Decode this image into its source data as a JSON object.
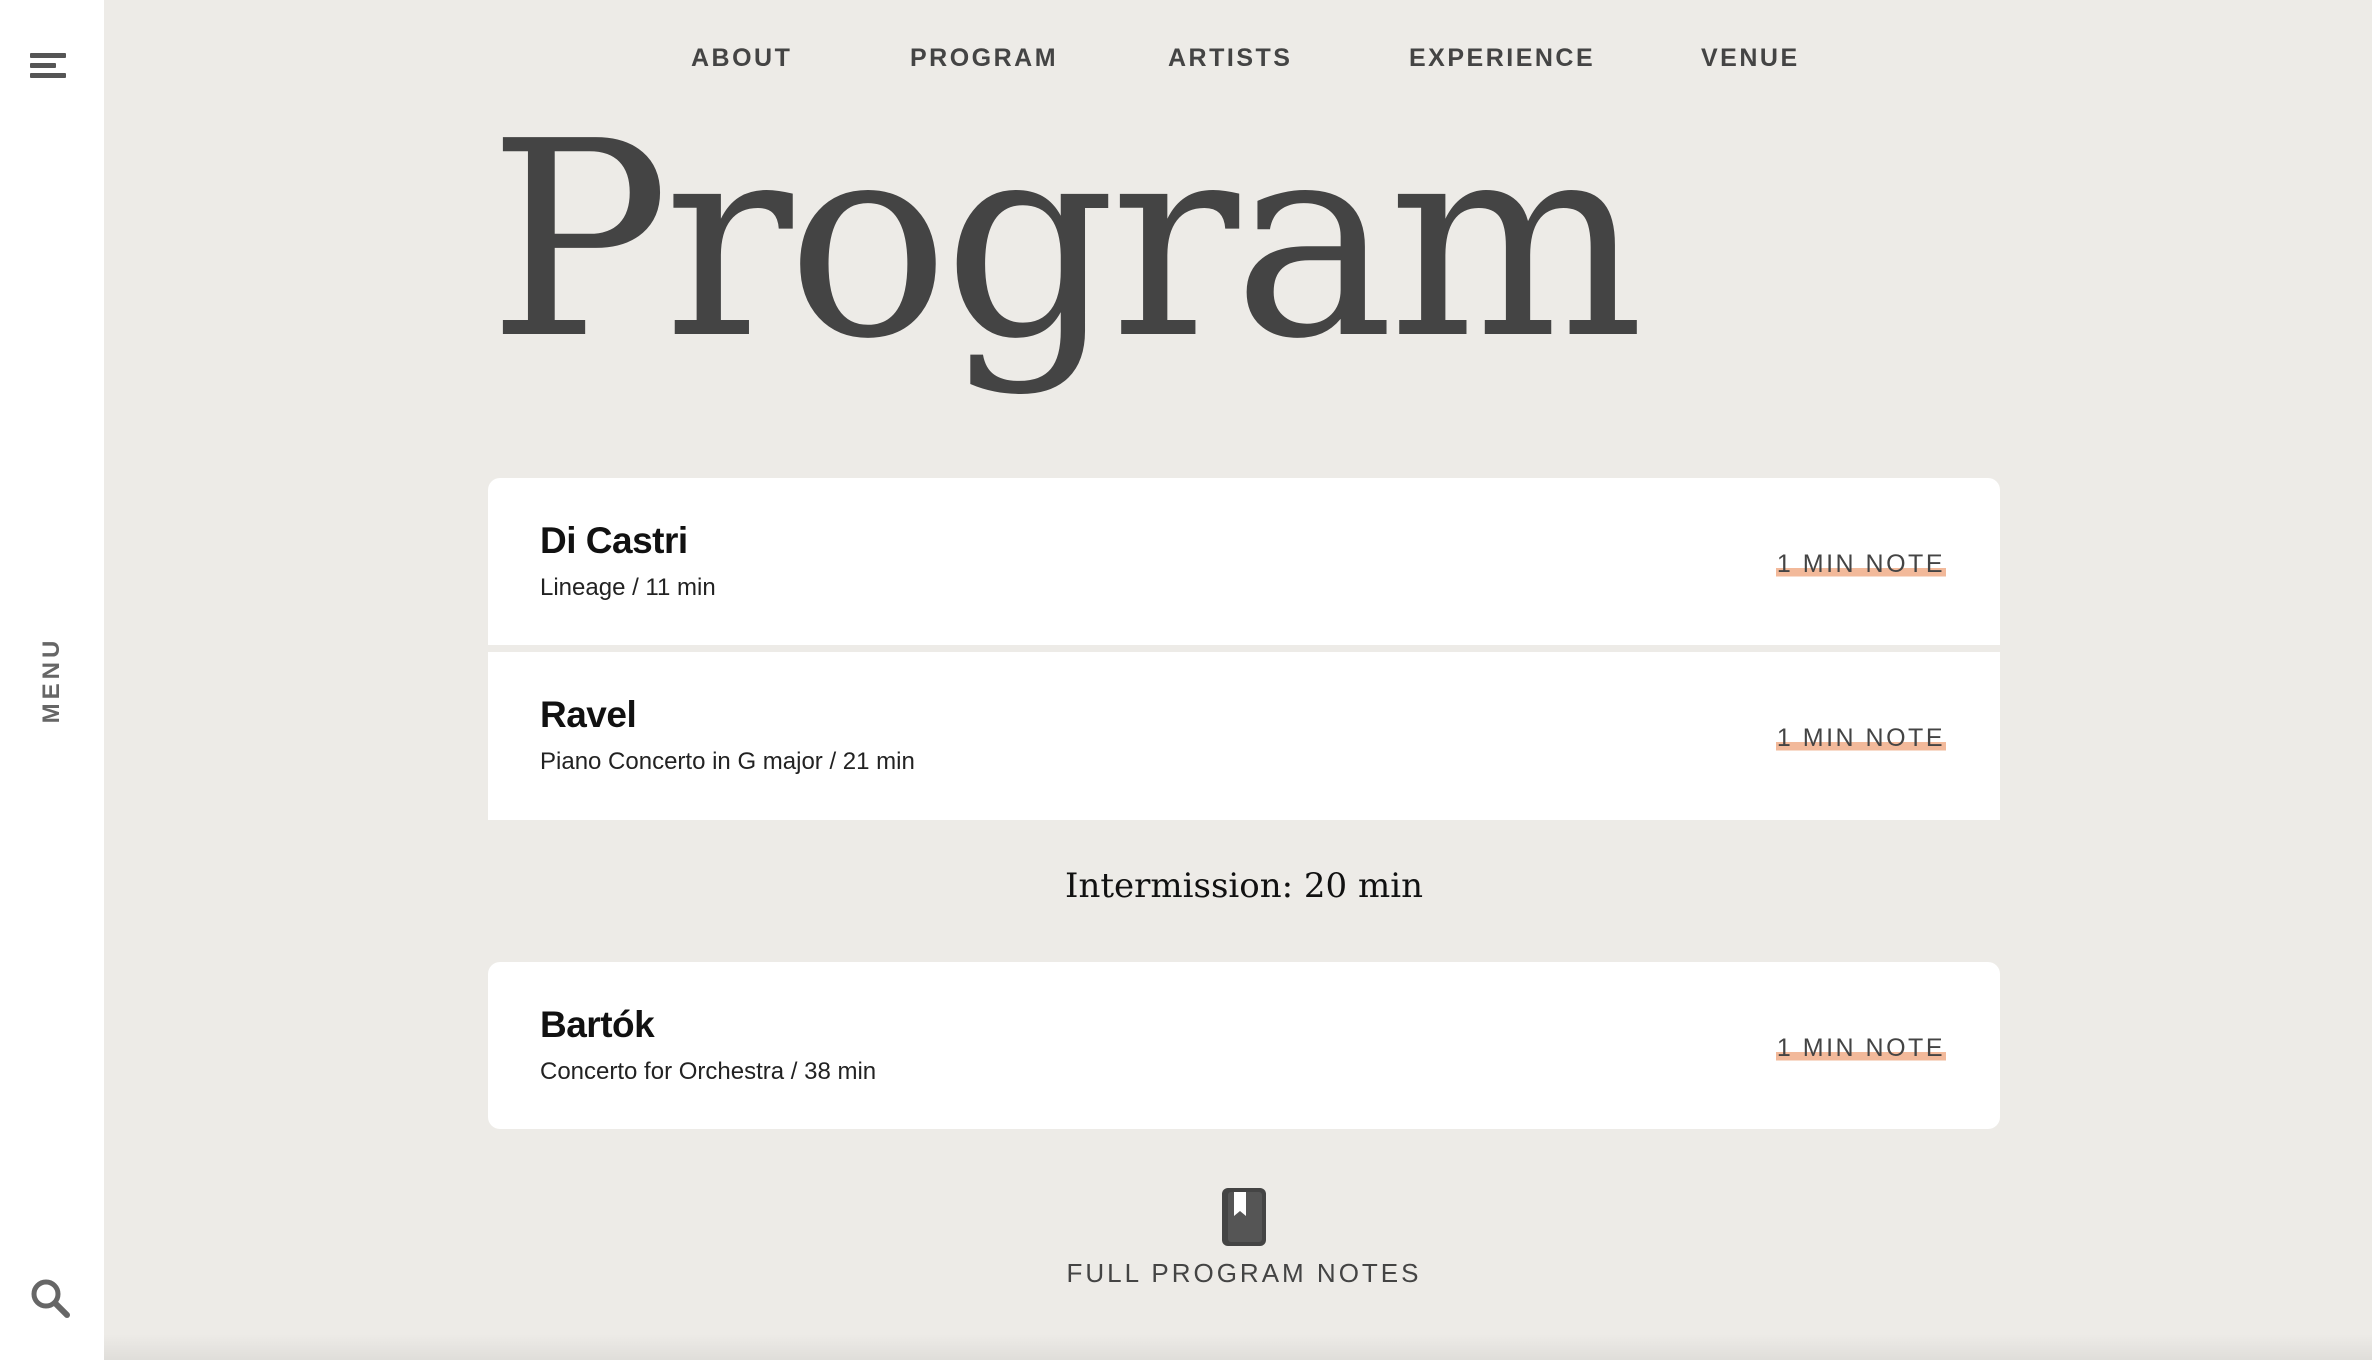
{
  "sidebar": {
    "menu_label": "MENU",
    "icons": [
      "hamburger-icon",
      "search-icon"
    ]
  },
  "nav": {
    "items": [
      "ABOUT",
      "PROGRAM",
      "ARTISTS",
      "EXPERIENCE",
      "VENUE"
    ]
  },
  "page": {
    "title": "Program"
  },
  "program": {
    "pieces": [
      {
        "composer": "Di Castri",
        "work": "Lineage / 11 min",
        "note_label": "1 MIN NOTE"
      },
      {
        "composer": "Ravel",
        "work": "Piano Concerto in G major / 21 min",
        "note_label": "1 MIN NOTE"
      },
      {
        "composer": "Bartók",
        "work": "Concerto for Orchestra / 38 min",
        "note_label": "1 MIN NOTE"
      }
    ],
    "intermission": "Intermission: 20 min",
    "full_notes_label": "FULL PROGRAM NOTES"
  },
  "colors": {
    "background": "#edebe7",
    "card": "#ffffff",
    "text": "#444444",
    "highlight": "#f2b99a"
  }
}
